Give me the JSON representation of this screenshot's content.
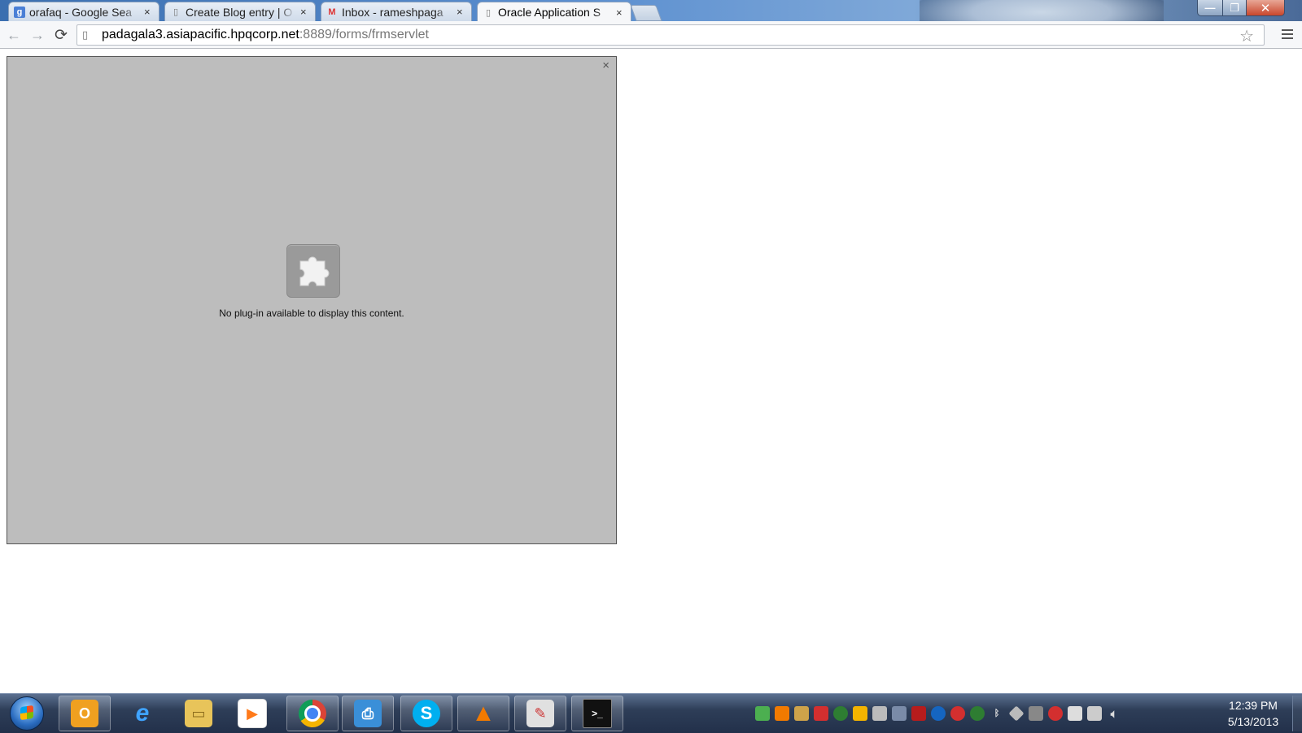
{
  "tabs": [
    {
      "title": "orafaq - Google Sea",
      "favicon": "google-icon",
      "active": false
    },
    {
      "title": "Create Blog entry | O",
      "favicon": "page-icon",
      "active": false
    },
    {
      "title": "Inbox - rameshpaga",
      "favicon": "gmail-icon",
      "active": false
    },
    {
      "title": "Oracle Application S",
      "favicon": "page-icon",
      "active": true
    }
  ],
  "window_controls": {
    "minimize": "—",
    "maximize": "❐",
    "close": "✕"
  },
  "toolbar": {
    "back": "←",
    "forward": "→",
    "reload": "⟳",
    "url_host": "padagala3.asiapacific.hpqcorp.net",
    "url_path": ":8889/forms/frmservlet",
    "star": "☆"
  },
  "plugin": {
    "close": "×",
    "message": "No plug-in available to display this content.",
    "bg_color": "#bdbdbd"
  },
  "taskbar": {
    "apps": [
      {
        "name": "outlook-icon",
        "glyph": "O",
        "color": "#f0a020"
      },
      {
        "name": "internet-explorer-icon",
        "glyph": "e",
        "color": "#1e88e5"
      },
      {
        "name": "file-explorer-icon",
        "glyph": "▭",
        "color": "#e8c45a"
      },
      {
        "name": "media-player-icon",
        "glyph": "▶",
        "color": "#ff7a1a"
      },
      {
        "name": "chrome-icon",
        "glyph": "◉",
        "color": "#d33"
      },
      {
        "name": "remote-desktop-icon",
        "glyph": "⎙",
        "color": "#3a8fd8"
      },
      {
        "name": "skype-icon",
        "glyph": "S",
        "color": "#00aff0"
      },
      {
        "name": "vlc-icon",
        "glyph": "▲",
        "color": "#f27a00"
      },
      {
        "name": "paint-app-icon",
        "glyph": "✎",
        "color": "#c0c0c0"
      },
      {
        "name": "command-prompt-icon",
        "glyph": ">_",
        "color": "#111"
      }
    ],
    "tray": [
      "#4caf50",
      "#f27a00",
      "#cfa34a",
      "#d32f2f",
      "#2e7d32",
      "#f4b400",
      "#bbb",
      "#7a8ba8",
      "#b71c1c",
      "#1565c0",
      "#d32f2f",
      "#2e7d32",
      "#ddd",
      "#bbb",
      "#888",
      "#d32f2f",
      "#ddd",
      "#ccc",
      "#ccc"
    ],
    "time": "12:39 PM",
    "date": "5/13/2013"
  }
}
